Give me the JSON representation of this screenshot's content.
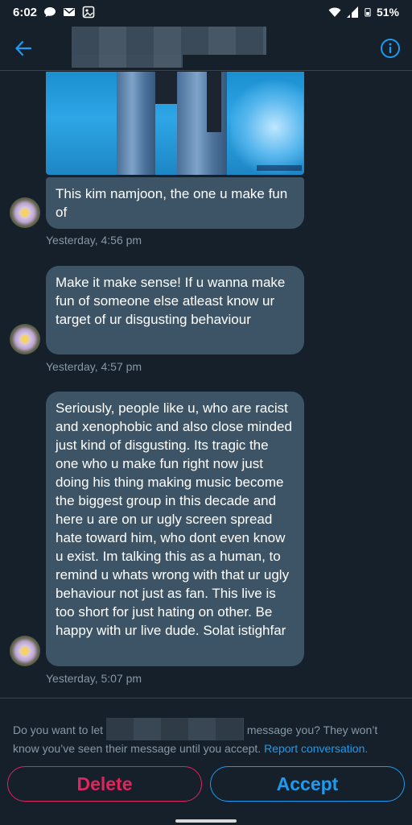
{
  "status_bar": {
    "time": "6:02",
    "battery": "51%",
    "left_icons": [
      "chat-bubble-icon",
      "gmail-icon",
      "photos-icon"
    ],
    "right_icons": [
      "wifi-icon",
      "signal-icon",
      "battery-icon"
    ]
  },
  "header": {
    "back_icon": "arrow-left-icon",
    "info_icon": "info-icon",
    "accent": "#1d9bf0"
  },
  "messages": [
    {
      "text": "This kim namjoon, the one u make fun of",
      "timestamp": "Yesterday, 4:56 pm"
    },
    {
      "text": "Make it make sense! If u wanna make fun of someone else atleast know ur target of ur disgusting behaviour",
      "timestamp": "Yesterday, 4:57 pm"
    },
    {
      "text": "Seriously, people like u, who are racist and xenophobic and also close minded just kind of disgusting. Its tragic the one who u make fun right now just doing his thing making music become the biggest group in this decade and here u are on ur ugly screen spread hate toward him, who dont even know u exist. Im talking this as a human, to remind u whats wrong with that ur ugly behaviour not just as fan. This live is too short for just hating on other. Be happy with ur live dude. Solat istighfar",
      "timestamp": "Yesterday, 5:07 pm"
    }
  ],
  "request": {
    "prompt_before": "Do you want to let ",
    "prompt_after": " message you? They won’t know you’ve seen their message until you accept. ",
    "report_link": "Report conversation.",
    "delete_label": "Delete",
    "accept_label": "Accept",
    "delete_color": "#e0245e",
    "accept_color": "#1d9bf0"
  }
}
